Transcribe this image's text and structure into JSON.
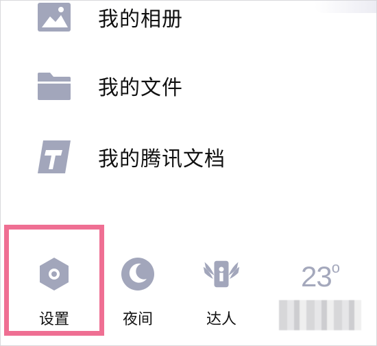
{
  "menu": {
    "items": [
      {
        "label": "我的相册",
        "icon": "album-icon"
      },
      {
        "label": "我的文件",
        "icon": "folder-icon"
      },
      {
        "label": "我的腾讯文档",
        "icon": "tencent-docs-icon"
      }
    ]
  },
  "toolbar": {
    "settings_label": "设置",
    "night_label": "夜间",
    "expert_label": "达人"
  },
  "weather": {
    "temperature": "23",
    "degree_symbol": "o"
  },
  "colors": {
    "icon": "#a2a6bb",
    "highlight": "#ef6f93",
    "text": "#111111"
  }
}
